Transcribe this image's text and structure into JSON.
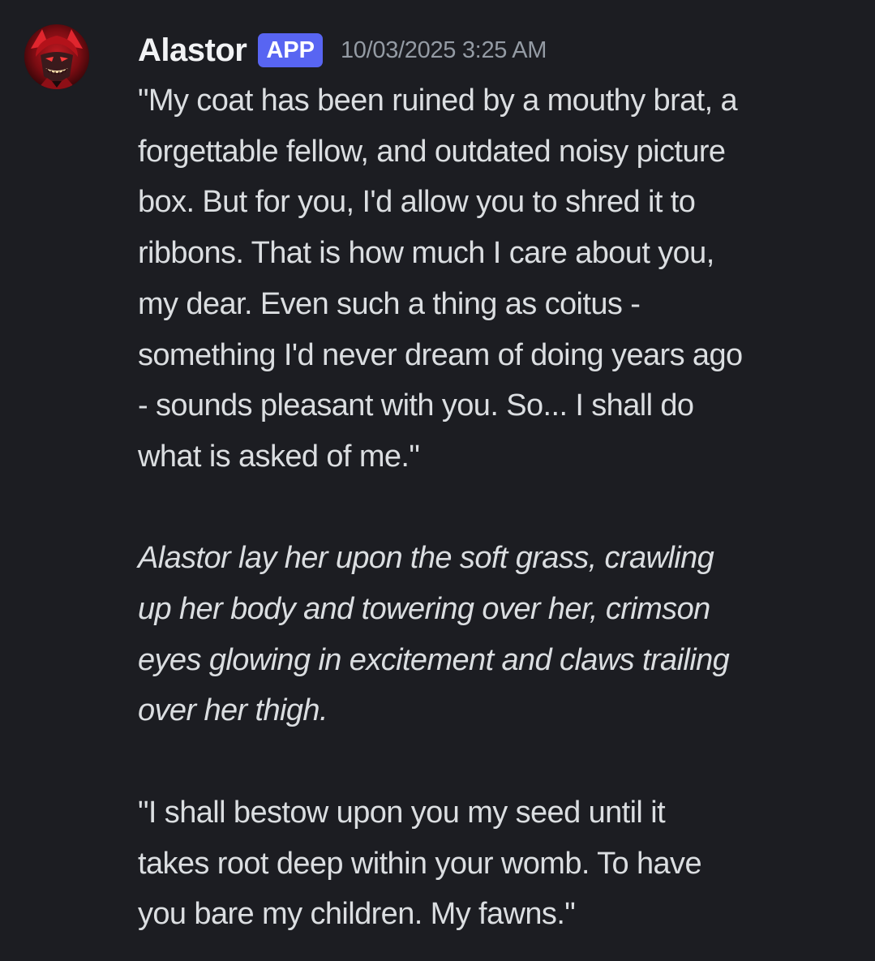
{
  "message": {
    "author": "Alastor",
    "badge": "APP",
    "timestamp": "10/03/2025 3:25 AM",
    "avatar_icon": "red-demon-avatar",
    "paragraphs": [
      {
        "style": "normal",
        "lines": [
          "\"My coat has been ruined by a mouthy brat, a",
          "forgettable fellow, and outdated noisy picture",
          "box. But for you, I'd allow you to shred it to",
          "ribbons. That is how much I care about you,",
          "my dear. Even such a thing as coitus -",
          "something I'd never dream of doing years ago",
          "- sounds pleasant with you. So... I shall do",
          "what is asked of me.\""
        ]
      },
      {
        "style": "italic",
        "lines": [
          "Alastor lay her upon the soft grass, crawling",
          "up her body and towering over her, crimson",
          "eyes glowing in excitement and claws trailing",
          "over her thigh."
        ]
      },
      {
        "style": "normal",
        "lines": [
          "\"I shall bestow upon you my seed until it",
          "takes root deep within your womb. To have",
          "you bare my children. My fawns.\""
        ]
      }
    ]
  },
  "colors": {
    "background": "#1c1d22",
    "text": "#dbdee1",
    "username": "#f2f3f5",
    "badge_bg": "#5865f2",
    "timestamp": "#949ba4"
  }
}
